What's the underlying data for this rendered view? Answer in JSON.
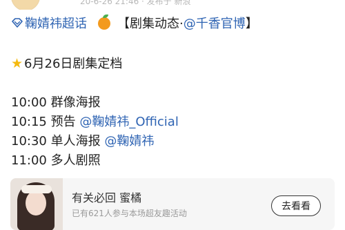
{
  "header": {
    "meta_text": "20-6-26 21:46 · 发布于 新浪"
  },
  "post": {
    "supertopic_icon": "supertopic-diamond-icon",
    "supertopic_name": "鞠婧祎超话",
    "orange_icon": "orange-emoji-icon",
    "title_text": "【剧集动态·",
    "title_mention": "@千香官博",
    "title_end": "】",
    "star_icon": "star-emoji-icon",
    "date_line": "6月26日剧集定档",
    "schedule": [
      {
        "time": "10:00",
        "text": "群像海报",
        "mention": ""
      },
      {
        "time": "10:15",
        "text": "预告",
        "mention": "@鞠婧祎_Official"
      },
      {
        "time": "10:30",
        "text": "单人海报",
        "mention": "@鞠婧祎"
      },
      {
        "time": "11:00",
        "text": "多人剧照",
        "mention": ""
      }
    ]
  },
  "card": {
    "thumbnail": "profile-photo",
    "title": "有关必回 蜜橘",
    "subtitle": "已有621人参与本场超友趣活动",
    "button_label": "去看看"
  },
  "colors": {
    "link": "#2f64b3",
    "card_bg": "#f6f6f6",
    "meta": "#b8b8b8"
  }
}
